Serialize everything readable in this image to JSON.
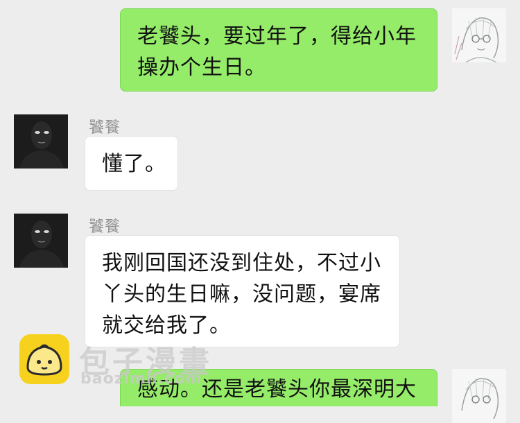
{
  "messages": [
    {
      "side": "right",
      "lines": [
        "老饕头，要过年了，得给小年",
        "操办个生日。"
      ]
    },
    {
      "side": "left",
      "sender": "饕餮",
      "lines": [
        "懂了。"
      ]
    },
    {
      "side": "left",
      "sender": "饕餮",
      "lines": [
        "我刚回国还没到住处，不过小",
        "丫头的生日嘛，没问题，宴席",
        "就交给我了。"
      ]
    },
    {
      "side": "right",
      "lines": [
        "感动。还是老饕头你最深明大"
      ]
    }
  ],
  "watermark": {
    "title": "包子漫畫",
    "url": "baozimh.com"
  },
  "colors": {
    "background": "#ededed",
    "bubble_self": "#95ec69",
    "bubble_other": "#ffffff",
    "sender_name": "#8e8e8e"
  },
  "icons": {
    "self_avatar": "sketch-character-avatar-icon",
    "other_avatar": "dark-figure-avatar-icon",
    "watermark_logo": "bun-logo-icon"
  }
}
